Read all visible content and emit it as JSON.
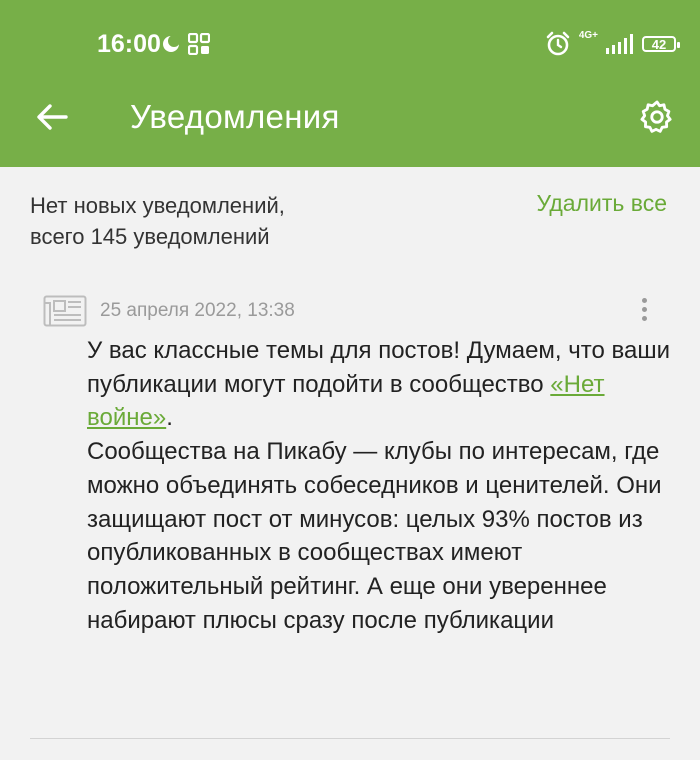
{
  "status_bar": {
    "time": "16:00",
    "network": "4G+",
    "battery": "42"
  },
  "header": {
    "title": "Уведомления"
  },
  "summary": {
    "line1": "Нет новых уведомлений,",
    "line2": "всего 145 уведомлений",
    "delete_all": "Удалить все"
  },
  "notification": {
    "date": "25 апреля 2022, 13:38",
    "text_before_link": "У вас классные темы для постов! Думаем, что ваши публикации могут подойти в сообщество ",
    "link": "«Нет войне»",
    "text_after_link": ".",
    "body": "Сообщества на Пикабу — клубы по интересам, где можно объединять собеседников и ценителей. Они защищают пост от минусов: целых 93% постов из опубликованных в сообществах имеют положительный рейтинг. А еще они увереннее набирают плюсы сразу после публикации"
  },
  "colors": {
    "header_bg": "#77af48",
    "accent": "#6aaa38",
    "background": "#f2f2f2"
  },
  "icons": {
    "back": "arrow-left-icon",
    "settings": "gear-icon",
    "notification": "newspaper-icon",
    "more": "more-vertical-icon"
  }
}
